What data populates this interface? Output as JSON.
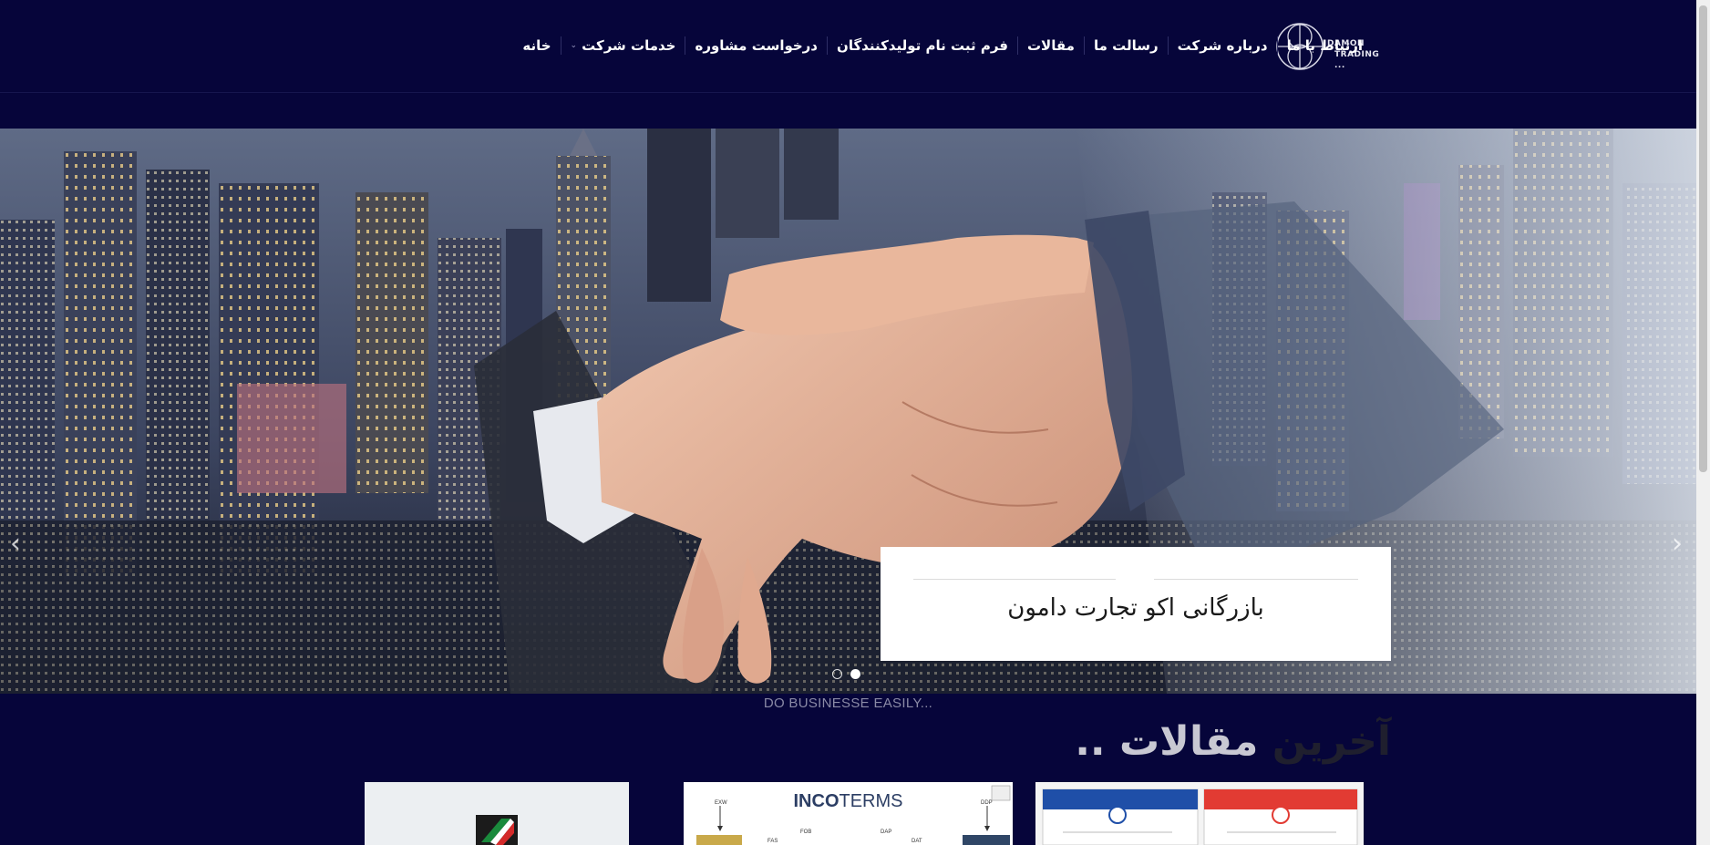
{
  "logo": {
    "line1": "DAMON",
    "line2": "TRADING ..."
  },
  "nav": {
    "items": [
      {
        "label": "خانه"
      },
      {
        "label": "خدمات شرکت",
        "has_dropdown": true
      },
      {
        "label": "درخواست مشاوره"
      },
      {
        "label": "فرم ثبت نام تولیدکنندگان"
      },
      {
        "label": "مقالات"
      },
      {
        "label": "رسالت ما"
      },
      {
        "label": "درباره شرکت"
      },
      {
        "label": "ارتباط با ما"
      }
    ]
  },
  "hero": {
    "caption": "بازرگانی اکو تجارت دامون",
    "prev_arrow": "‹",
    "next_arrow": "›",
    "slides_total": 2,
    "active_slide": 2
  },
  "tagline": "DO BUSINESSE EASILY...",
  "articles": {
    "title_word1": "آخرین",
    "title_word2": "مقالات ..",
    "incoterms_label_bold": "INCO",
    "incoterms_label_rest": "TERMS",
    "incoterms_terms": [
      "EXW",
      "FOB",
      "DAP",
      "DDP",
      "FAS",
      "DAT"
    ]
  },
  "colors": {
    "page_background": "#06053a",
    "nav_text": "#ffffff",
    "caption_background": "#ffffff",
    "tagline_text": "#8a8aa6"
  }
}
